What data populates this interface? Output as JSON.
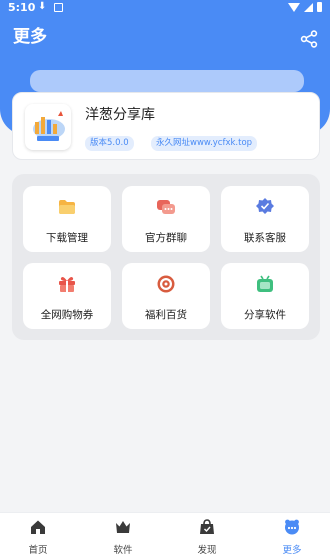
{
  "status_bar": {
    "time": "5:10",
    "download_glyph": "⬇"
  },
  "header": {
    "title": "更多",
    "share_icon": "share-icon"
  },
  "app_card": {
    "name": "洋葱分享库",
    "version_tag": "版本5.0.0",
    "url_tag": "永久网址www.ycfxk.top",
    "logo_text": "洋葱分享库"
  },
  "grid": {
    "items": [
      {
        "label": "下载管理",
        "icon": "folder-icon"
      },
      {
        "label": "官方群聊",
        "icon": "chat-icon"
      },
      {
        "label": "联系客服",
        "icon": "badge-icon"
      },
      {
        "label": "全网购物券",
        "icon": "gift-icon"
      },
      {
        "label": "福利百货",
        "icon": "target-icon"
      },
      {
        "label": "分享软件",
        "icon": "tv-icon"
      }
    ]
  },
  "bottom_nav": {
    "items": [
      {
        "label": "首页",
        "icon": "home-icon"
      },
      {
        "label": "软件",
        "icon": "crown-icon"
      },
      {
        "label": "发现",
        "icon": "bag-icon"
      },
      {
        "label": "更多",
        "icon": "more-icon",
        "active": true
      }
    ]
  },
  "colors": {
    "primary": "#4a8bf5",
    "background": "#f3f4f6"
  }
}
